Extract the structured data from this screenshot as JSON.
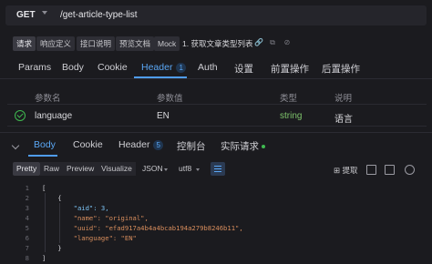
{
  "url_bar": {
    "method": "GET",
    "path": "/get-article-type-list"
  },
  "toolbar": {
    "tabs": [
      "请求",
      "响应定义",
      "接口说明",
      "预览文档",
      "Mock"
    ],
    "title": "1. 获取文章类型列表"
  },
  "request_tabs": {
    "items": [
      {
        "label": "Params"
      },
      {
        "label": "Body"
      },
      {
        "label": "Cookie"
      },
      {
        "label": "Header",
        "badge": "1"
      },
      {
        "label": "Auth"
      },
      {
        "label": "设置"
      },
      {
        "label": "前置操作"
      },
      {
        "label": "后置操作"
      }
    ],
    "active": "Header"
  },
  "params_table": {
    "headers": [
      "参数名",
      "参数值",
      "类型",
      "说明"
    ],
    "rows": [
      {
        "name": "language",
        "value": "EN",
        "type": "string",
        "desc": "语言",
        "enabled": true
      }
    ]
  },
  "response_tabs": {
    "items": [
      {
        "label": "Body"
      },
      {
        "label": "Cookie"
      },
      {
        "label": "Header",
        "badge": "5"
      },
      {
        "label": "控制台"
      },
      {
        "label": "实际请求"
      }
    ],
    "active": "Body"
  },
  "response_toolbar": {
    "formats": [
      "Pretty",
      "Raw",
      "Preview",
      "Visualize"
    ],
    "active_format": "Pretty",
    "lang": "JSON",
    "encoding": "utf8",
    "extract_label": "提取"
  },
  "code": {
    "line_numbers": [
      "1",
      "2",
      "3",
      "4",
      "5",
      "6",
      "7",
      "8"
    ],
    "lines": [
      "[",
      "    {",
      "        \"aid\": 3,",
      "        \"name\": \"original\",",
      "        \"uuid\": \"efad917a4b4a4bcab194a279b8246b11\",",
      "        \"language\": \"EN\"",
      "    }",
      "]"
    ]
  }
}
